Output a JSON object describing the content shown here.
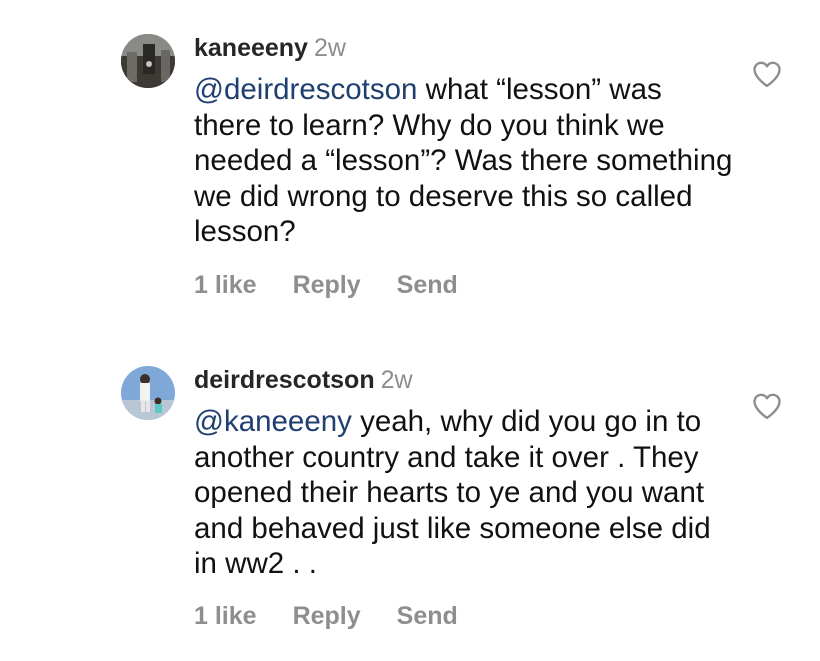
{
  "comments": [
    {
      "username": "kaneeeny",
      "time": "2w",
      "mention": "@deirdrescotson",
      "text": " what “lesson” was there to learn? Why do you think we needed a “lesson”? Was there something we did wrong to deserve this so called lesson?",
      "likes_label": "1 like",
      "reply_label": "Reply",
      "send_label": "Send",
      "icon": "heart-outline-icon"
    },
    {
      "username": "deirdrescotson",
      "time": "2w",
      "mention": "@kaneeeny",
      "text": " yeah,  why did you go in to another country and take it over . They opened their hearts to ye and you want and behaved just like someone else did in ww2 . .",
      "likes_label": "1 like",
      "reply_label": "Reply",
      "send_label": "Send",
      "icon": "heart-outline-icon"
    }
  ],
  "colors": {
    "mention": "#1f3f70",
    "muted": "#8e8e8e",
    "username": "#262626"
  }
}
